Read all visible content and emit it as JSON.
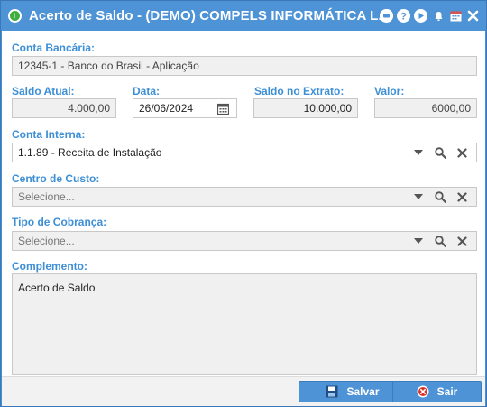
{
  "window": {
    "title": "Acerto de Saldo - (DEMO) COMPELS INFORMÁTICA L...",
    "app_icon_glyph": "↑",
    "title_icons": [
      "chat-icon",
      "help-icon",
      "play-icon",
      "bell-icon",
      "calendar-icon",
      "close-icon"
    ]
  },
  "form": {
    "conta_bancaria": {
      "label": "Conta Bancária:",
      "value": "12345-1 - Banco do Brasil - Aplicação"
    },
    "saldo_atual": {
      "label": "Saldo Atual:",
      "value": "4.000,00"
    },
    "data": {
      "label": "Data:",
      "value": "26/06/2024"
    },
    "saldo_extrato": {
      "label": "Saldo no Extrato:",
      "value": "10.000,00"
    },
    "valor": {
      "label": "Valor:",
      "value": "6000,00"
    },
    "conta_interna": {
      "label": "Conta Interna:",
      "value": "1.1.89 - Receita de Instalação"
    },
    "centro_custo": {
      "label": "Centro de Custo:",
      "placeholder": "Selecione..."
    },
    "tipo_cobranca": {
      "label": "Tipo de Cobrança:",
      "placeholder": "Selecione..."
    },
    "complemento": {
      "label": "Complemento:",
      "value": "Acerto de Saldo"
    }
  },
  "footer": {
    "save_label": "Salvar",
    "exit_label": "Sair"
  },
  "colors": {
    "titlebar": "#4e93d6",
    "label": "#3d8fd6",
    "button": "#4e93d6"
  }
}
